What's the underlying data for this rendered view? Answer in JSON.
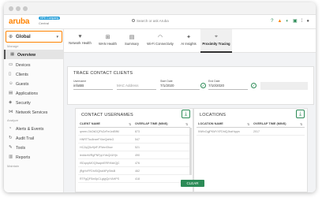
{
  "brand": {
    "logo": "aruba",
    "badge": "HPE Company",
    "subtitle": "Central"
  },
  "search": {
    "placeholder": "Search or ask Aruba"
  },
  "top_icons": [
    "help-icon",
    "bell-icon",
    "support-icon",
    "cart-icon",
    "grid-icon",
    "user-icon"
  ],
  "sidebar": {
    "context": "Global",
    "sections": {
      "manage": "Manage",
      "analyze": "Analyze",
      "maintain": "Maintain"
    },
    "items": [
      {
        "label": "Overview",
        "icon": "overview-icon",
        "active": true
      },
      {
        "label": "Devices",
        "icon": "devices-icon"
      },
      {
        "label": "Clients",
        "icon": "clients-icon"
      },
      {
        "label": "Guests",
        "icon": "guests-icon"
      },
      {
        "label": "Applications",
        "icon": "applications-icon"
      },
      {
        "label": "Security",
        "icon": "security-icon"
      },
      {
        "label": "Network Services",
        "icon": "network-services-icon"
      },
      {
        "label": "Alerts & Events",
        "icon": "alerts-icon"
      },
      {
        "label": "Audit Trail",
        "icon": "audit-trail-icon"
      },
      {
        "label": "Tools",
        "icon": "tools-icon"
      },
      {
        "label": "Reports",
        "icon": "reports-icon"
      }
    ]
  },
  "tabs": [
    {
      "label": "Network Health",
      "icon": "network-health-icon"
    },
    {
      "label": "WAN Health",
      "icon": "wan-health-icon"
    },
    {
      "label": "Summary",
      "icon": "summary-icon"
    },
    {
      "label": "Wi-Fi Connectivity",
      "icon": "wifi-icon"
    },
    {
      "label": "AI Insights",
      "icon": "ai-insights-icon"
    },
    {
      "label": "Proximity Tracing",
      "icon": "proximity-tracing-icon",
      "active": true
    }
  ],
  "trace": {
    "title": "TRACE CONTACT CLIENTS",
    "username_label": "Username",
    "username_value": "infoBB",
    "mac_placeholder": "MAC Address",
    "start_label": "Start Date",
    "start_value": "7/1/2020",
    "end_label": "End Date",
    "end_value": "7/10/2020"
  },
  "contacts": {
    "title": "CONTACT USERNAMES",
    "columns": [
      "CLIENT NAME",
      "OVERLAP TIME (MINS)"
    ],
    "rows": [
      {
        "name": "qmee-OkOkDQFhZzFm1rdBfM",
        "time": "873"
      },
      {
        "name": "HNRTTcu5nxeFXkeQdrfcG",
        "time": "547"
      },
      {
        "name": "HCZqQ5z9jrlFJFNnnSfow",
        "time": "521"
      },
      {
        "name": "ieddzxWRgPNFppYdsQrUHjn",
        "time": "490"
      },
      {
        "name": "ISDqnpMOQ5wqmERRrNxIQjC",
        "time": "476"
      },
      {
        "name": "jRgHvFFDhiSiQbzMPySbsB",
        "time": "462"
      },
      {
        "name": "RTFgQFSm5pCLgtyjQxYAHPS",
        "time": "418"
      }
    ]
  },
  "locations": {
    "title": "LOCATIONS",
    "columns": [
      "LOCATION NAME",
      "OVERLAP TIME (MINS)"
    ],
    "rows": [
      {
        "name": "INWxOgjPKMYXFDhlQJbaHqqm",
        "time": "2017"
      }
    ]
  },
  "clear_label": "CLEAR",
  "colors": {
    "accent": "#ff8300",
    "primary": "#2c8b57",
    "brand_badge": "#29a0d9"
  }
}
